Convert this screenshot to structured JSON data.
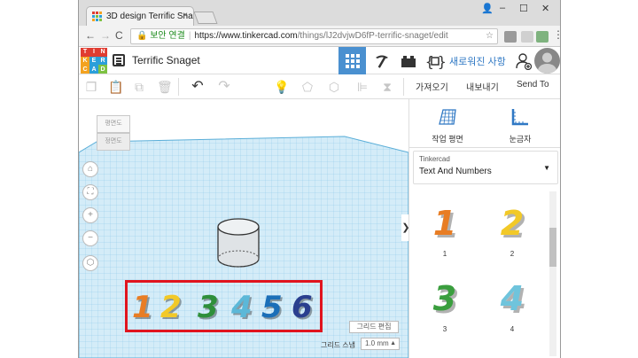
{
  "browser": {
    "tab_title": "3D design Terrific Snage",
    "tab_close": "×",
    "window_controls": {
      "minimize": "–",
      "maximize": "☐",
      "close": "✕"
    },
    "nav": {
      "back": "←",
      "forward": "→",
      "reload": "C"
    },
    "address": {
      "secure_label": "보안 연결",
      "host": "https://www.tinkercad.com",
      "path": "/things/lJ2dvjwD6fP-terrific-snaget/edit"
    }
  },
  "header": {
    "logo_letters": [
      "T",
      "I",
      "N",
      "K",
      "E",
      "R",
      "C",
      "A",
      "D"
    ],
    "logo_colors": [
      "#e03c31",
      "#e03c31",
      "#e03c31",
      "#f3a21f",
      "#2b9fd9",
      "#2b9fd9",
      "#f3a21f",
      "#2b9fd9",
      "#7dc242"
    ],
    "title": "Terrific Snaget",
    "news_label": "새로워진 사항",
    "mode_active_color": "#4a90d0"
  },
  "toolbar": {
    "import_label": "가져오기",
    "export_label": "내보내기",
    "sendto_label": "Send To"
  },
  "workplane": {
    "viewcube_top": "평면도",
    "viewcube_front": "정면도",
    "grid_edit_label": "그리드 편집",
    "snap_label": "그리드 스냅",
    "snap_value": "1.0 mm",
    "collapse_glyph": "❯",
    "numbers": [
      "1",
      "2",
      "3",
      "4",
      "5",
      "6"
    ],
    "number_colors": [
      "#e87d24",
      "#f2c928",
      "#2e8f3a",
      "#5bb8d8",
      "#1b6fb8",
      "#2a3f8f"
    ],
    "highlight_color": "#e0141e"
  },
  "panel": {
    "workplane_label": "작업 평면",
    "ruler_label": "눈금자",
    "library_source": "Tinkercad",
    "library_selected": "Text And Numbers",
    "shapes": [
      {
        "label": "1",
        "glyph": "1",
        "color": "#e87d24"
      },
      {
        "label": "2",
        "glyph": "2",
        "color": "#f2c928"
      },
      {
        "label": "3",
        "glyph": "3",
        "color": "#3a9e3e"
      },
      {
        "label": "4",
        "glyph": "4",
        "color": "#6fc4dc"
      }
    ]
  }
}
